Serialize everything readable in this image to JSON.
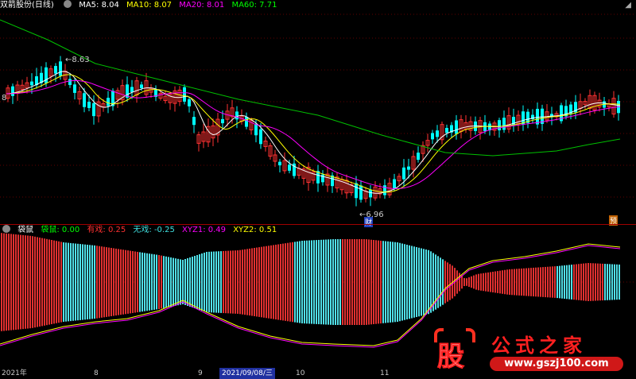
{
  "main": {
    "title": "双箭股份(日线)",
    "indicators": [
      {
        "label": "MA5: 8.04",
        "color": "#ffffff"
      },
      {
        "label": "MA10: 8.07",
        "color": "#ffff00"
      },
      {
        "label": "MA20: 8.01",
        "color": "#ff00ff"
      },
      {
        "label": "MA60: 7.71",
        "color": "#00ff00"
      }
    ],
    "high_label": "8.63",
    "low_label": "6.96",
    "left_price": "8",
    "badge_cai": "财",
    "badge_yu": "预"
  },
  "sub": {
    "title": "袋鼠",
    "indicators": [
      {
        "label": "袋鼠: 0.00",
        "color": "#00ff00"
      },
      {
        "label": "有戏: 0.25",
        "color": "#ff3030"
      },
      {
        "label": "无戏: -0.25",
        "color": "#40e0e0"
      },
      {
        "label": "XYZ1: 0.49",
        "color": "#ff00ff"
      },
      {
        "label": "XYZ2: 0.51",
        "color": "#ffff00"
      }
    ]
  },
  "axis": {
    "year": "2021年",
    "m8": "8",
    "m9": "9",
    "date": "2021/09/08/三",
    "m10": "10",
    "m11": "11"
  },
  "logo": {
    "char": "股",
    "name": "公式之家",
    "url": "www.gszj100.com"
  },
  "colors": {
    "up": "#ff3232",
    "down": "#00ffff",
    "bar_red": "#e03030",
    "bar_cyan": "#50e0e8"
  }
}
